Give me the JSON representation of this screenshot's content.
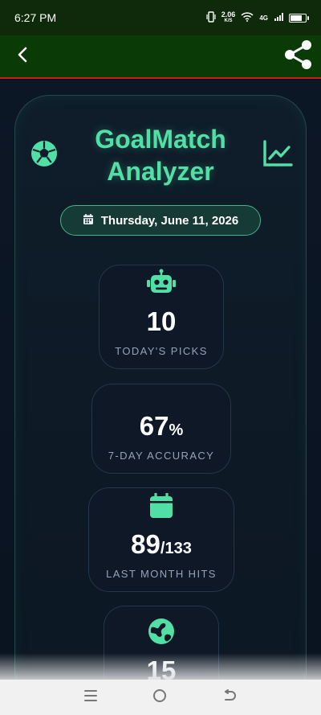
{
  "status_bar": {
    "time": "6:27 PM",
    "net_speed": "2.06",
    "net_unit": "K/S",
    "network": "4G",
    "battery_level": 0.75
  },
  "app_bar": {
    "back_icon": "chevron-left-icon",
    "share_icon": "share-icon"
  },
  "header": {
    "title_line1": "GoalMatch",
    "title_line2": "Analyzer",
    "left_icon": "soccer-ball-icon",
    "right_icon": "chart-line-icon"
  },
  "date": {
    "icon": "calendar-icon",
    "label": "Thursday, June 11, 2026"
  },
  "stats": [
    {
      "icon": "robot-icon",
      "value": "10",
      "suffix": "",
      "label": "TODAY'S PICKS"
    },
    {
      "icon": "",
      "value": "67",
      "suffix": "%",
      "label": "7-DAY ACCURACY"
    },
    {
      "icon": "calendar-check-icon",
      "value": "89",
      "suffix": "/133",
      "label": "LAST MONTH HITS"
    },
    {
      "icon": "globe-icon",
      "value": "15",
      "suffix": "",
      "label": ""
    }
  ],
  "colors": {
    "accent": "#52dfa6",
    "app_bar": "#0a3a06",
    "app_bar_border": "#d11a1a",
    "background": "#0b1421"
  },
  "nav": {
    "recents_icon": "menu-icon",
    "home_icon": "circle-home-icon",
    "back_icon": "back-arrow-icon"
  }
}
